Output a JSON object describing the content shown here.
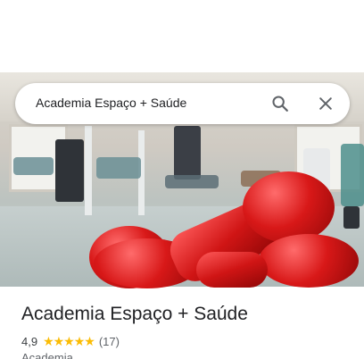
{
  "search": {
    "query": "Academia Espaço + Saúde",
    "search_icon": "search-icon",
    "close_icon": "close-icon"
  },
  "hero": {
    "subject": "gym-photo-icon",
    "accent_color": "#d11616"
  },
  "place": {
    "title": "Academia Espaço + Saúde",
    "rating": "4,9",
    "stars": "★★★★★",
    "star_color": "#fbbc04",
    "review_count": "(17)",
    "category": "Academia"
  }
}
